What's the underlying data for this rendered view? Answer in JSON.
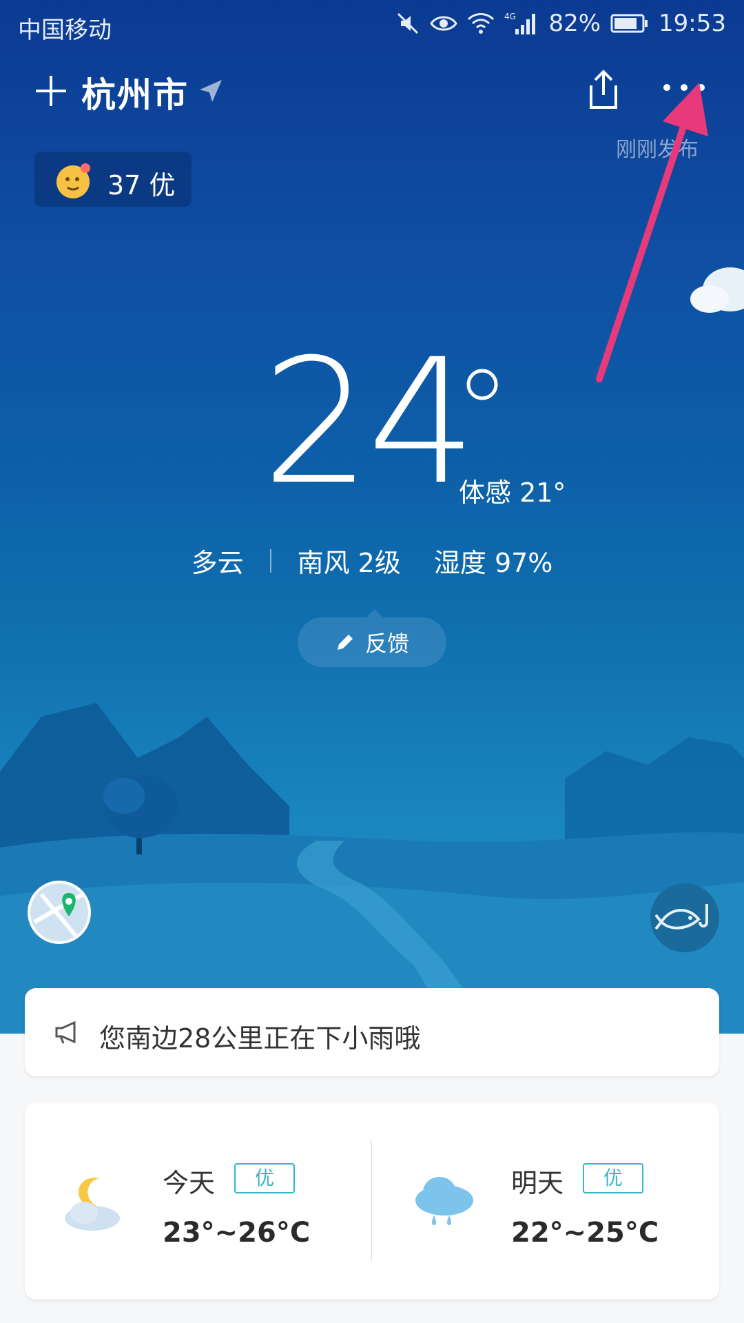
{
  "status_bar": {
    "carrier": "中国移动",
    "network": "4G",
    "battery_percent": "82%",
    "time": "19:53"
  },
  "header": {
    "city": "杭州市",
    "publish_time": "刚刚发布"
  },
  "aqi": {
    "label": "37 优"
  },
  "current": {
    "temperature": "24",
    "feels_like": "体感 21°",
    "condition": "多云",
    "wind": "南风 2级",
    "humidity": "湿度 97%"
  },
  "feedback": {
    "label": "反馈"
  },
  "alert": {
    "text": "您南边28公里正在下小雨哦"
  },
  "forecast": [
    {
      "day": "今天",
      "aqi": "优",
      "temp_range": "23°~26°C",
      "icon": "moon-cloud-icon"
    },
    {
      "day": "明天",
      "aqi": "优",
      "temp_range": "22°~25°C",
      "icon": "rain-cloud-icon"
    }
  ],
  "colors": {
    "sky_top": "#0b3a92",
    "sky_bottom": "#2a95c8",
    "annotation_arrow": "#e83a7a",
    "aqi_badge": "#35b6c7"
  }
}
